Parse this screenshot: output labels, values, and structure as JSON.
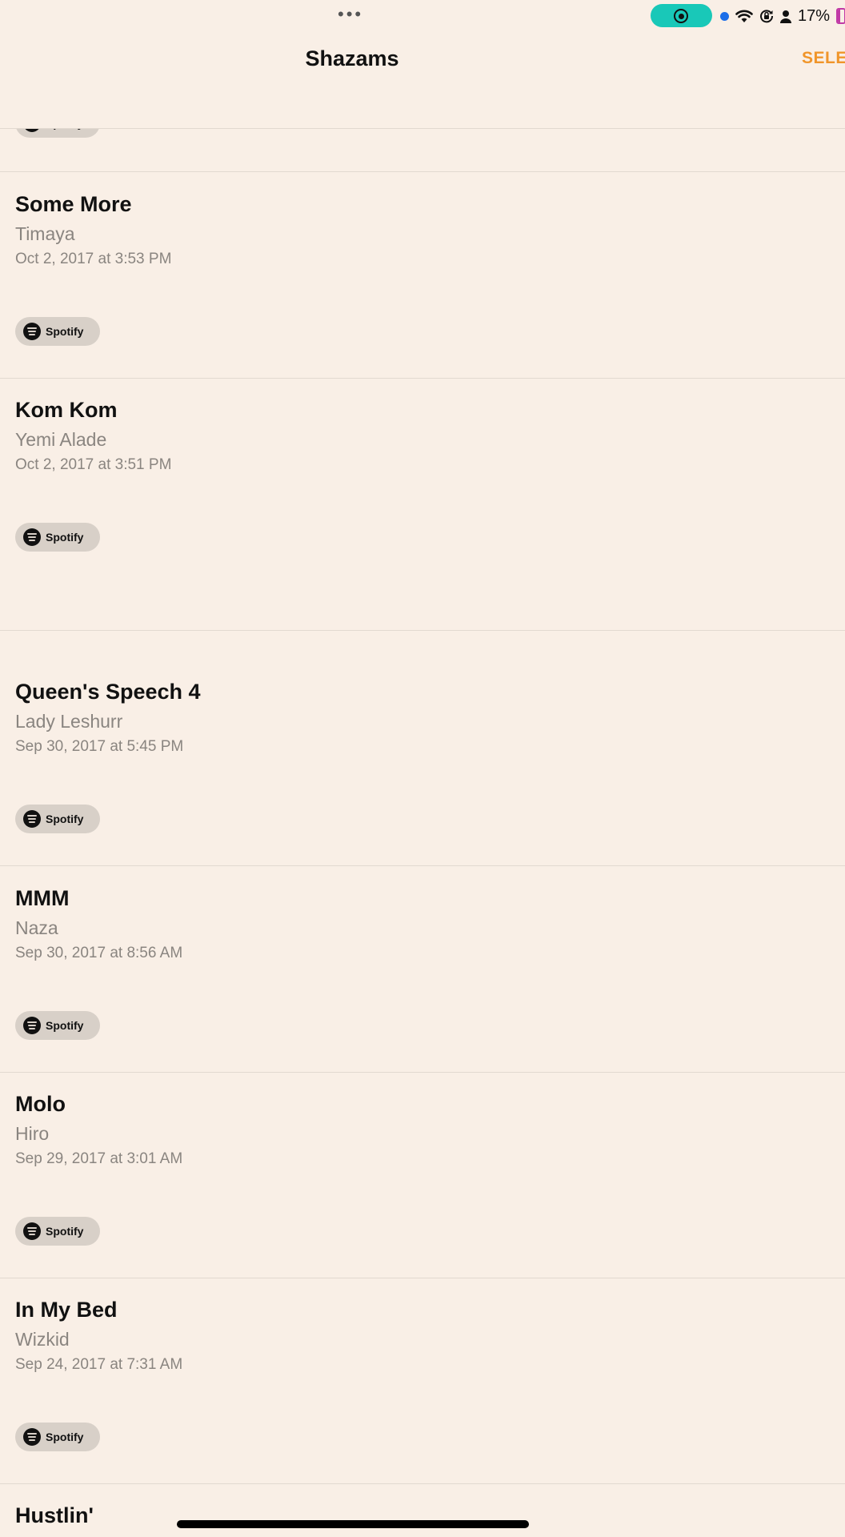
{
  "status_bar": {
    "dots": "•••",
    "battery_percent": "17%"
  },
  "nav": {
    "title": "Shazams",
    "action_label": "SELE"
  },
  "spotify_label": "Spotify",
  "items": [
    {
      "title": "Some More",
      "artist": "Timaya",
      "date": "Oct 2, 2017 at 3:53 PM"
    },
    {
      "title": "Kom Kom",
      "artist": "Yemi Alade",
      "date": "Oct 2, 2017 at 3:51 PM"
    },
    {
      "title": "Queen's Speech 4",
      "artist": "Lady Leshurr",
      "date": "Sep 30, 2017 at 5:45 PM"
    },
    {
      "title": "MMM",
      "artist": "Naza",
      "date": "Sep 30, 2017 at 8:56 AM"
    },
    {
      "title": "Molo",
      "artist": "Hiro",
      "date": "Sep 29, 2017 at 3:01 AM"
    },
    {
      "title": "In My Bed",
      "artist": "Wizkid",
      "date": "Sep 24, 2017 at 7:31 AM"
    },
    {
      "title": "Hustlin'"
    }
  ]
}
